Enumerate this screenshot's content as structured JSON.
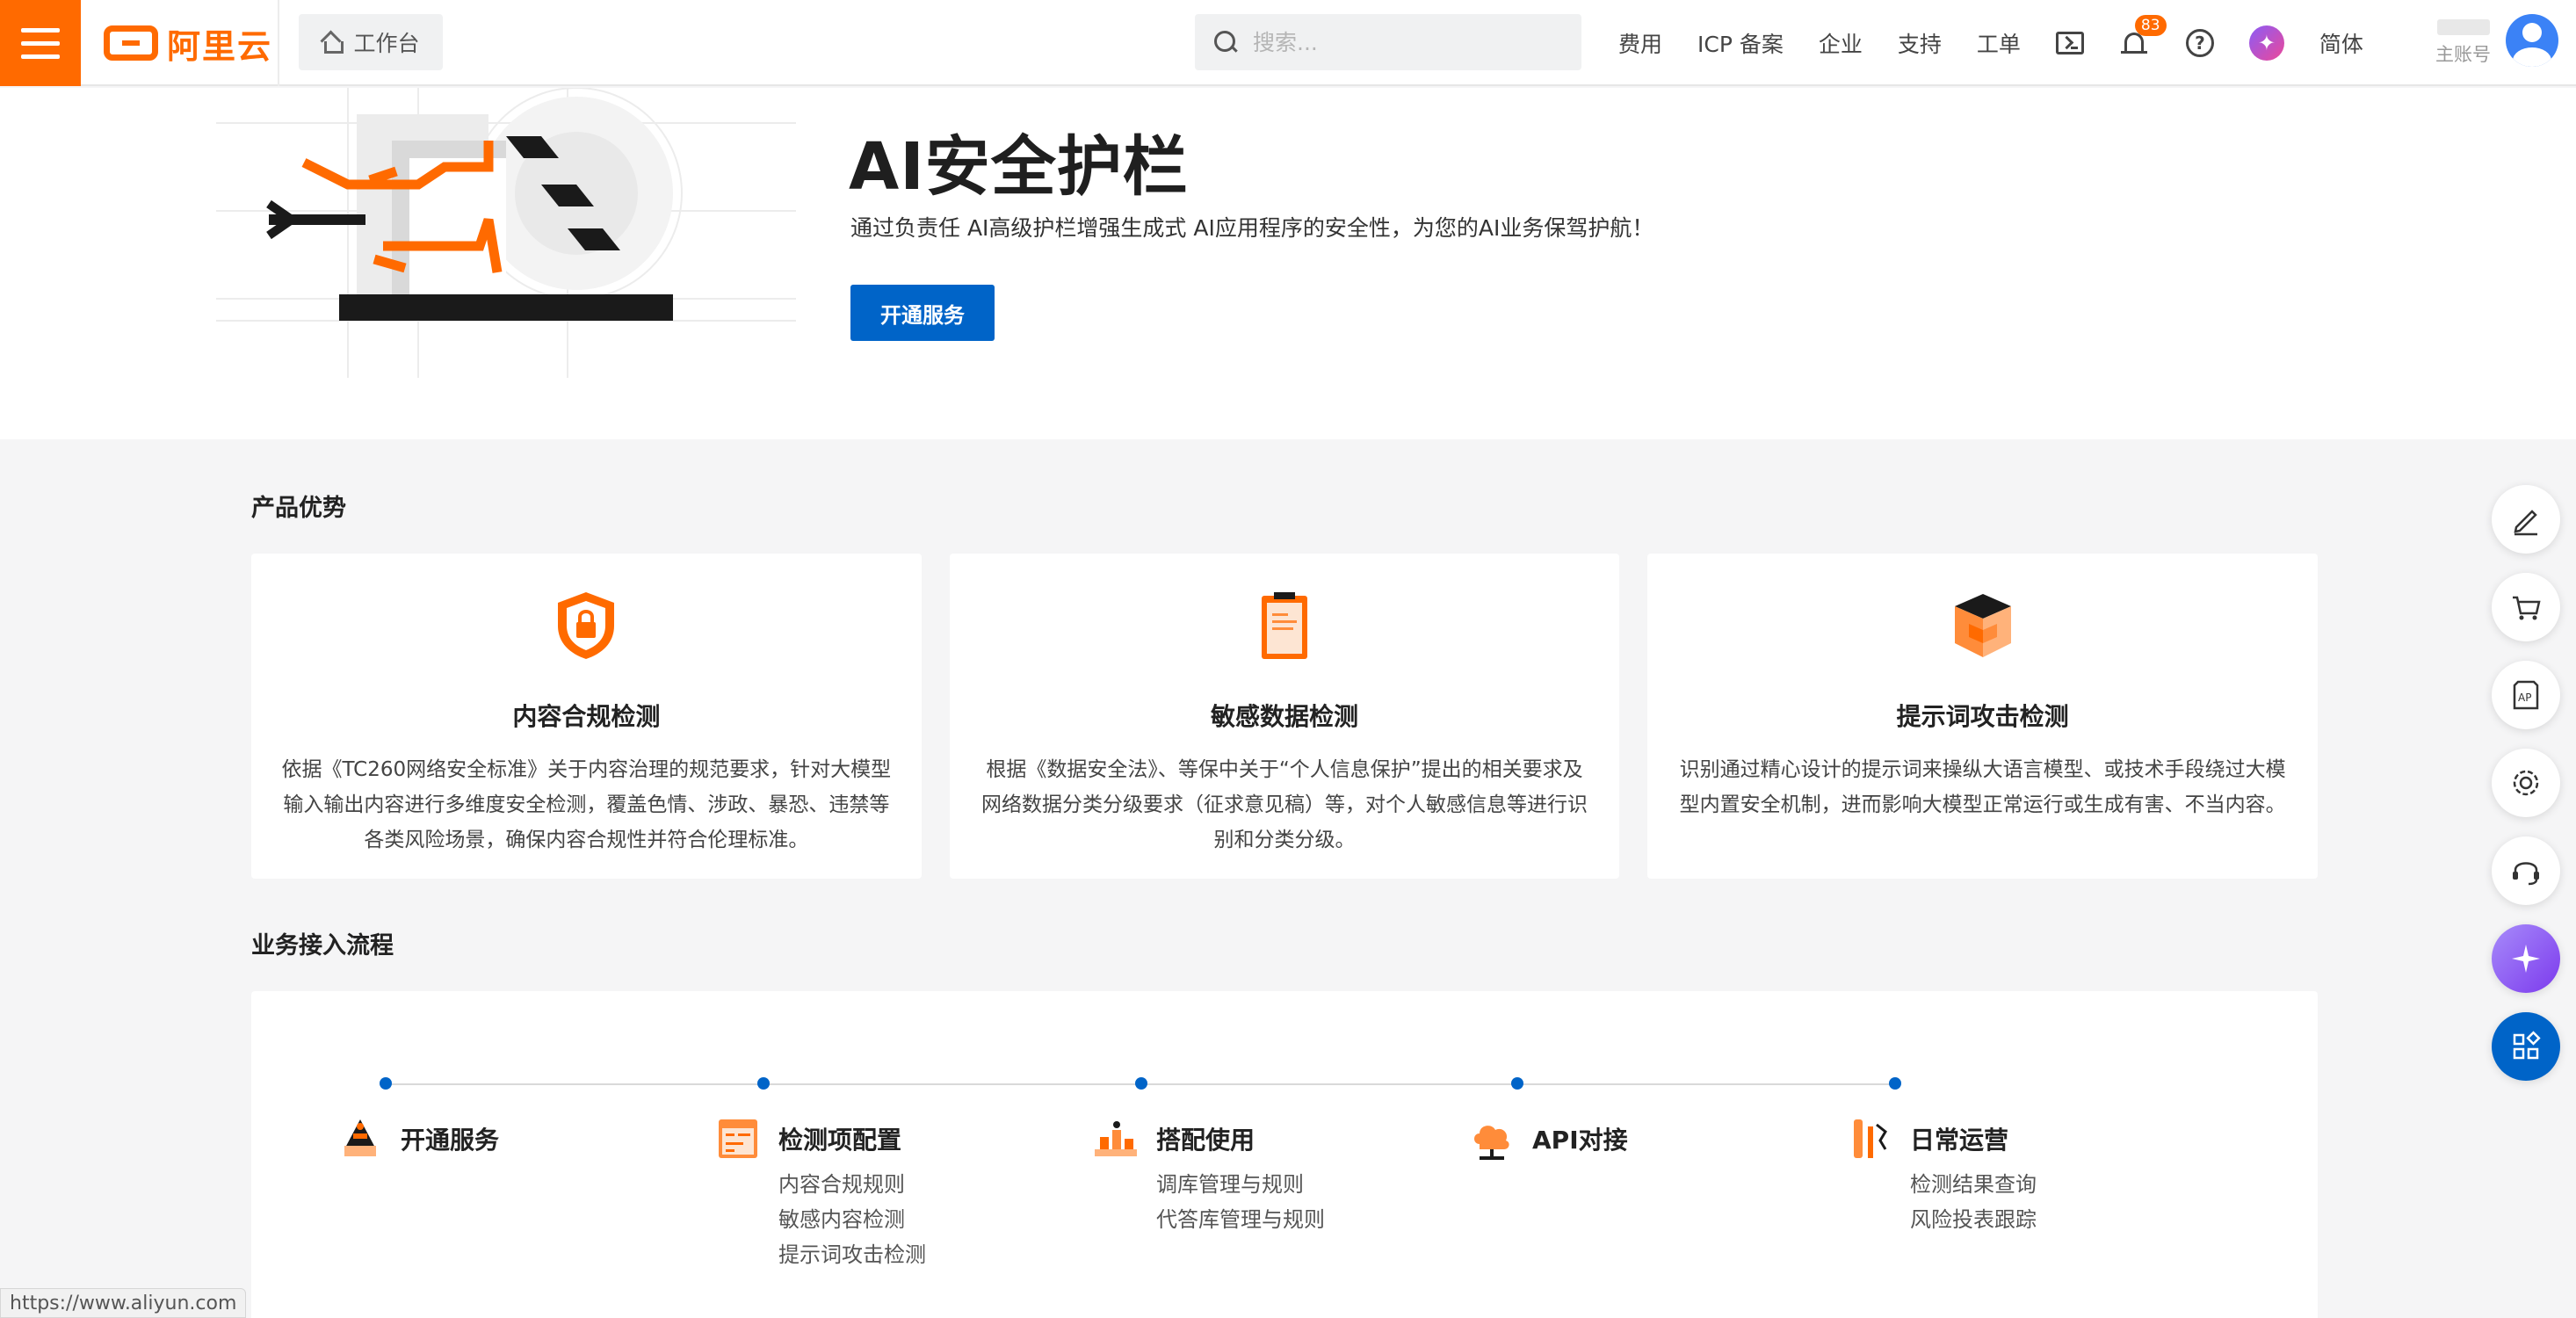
{
  "header": {
    "logo_text": "阿里云",
    "workbench_label": "工作台",
    "search_placeholder": "搜索...",
    "nav": [
      "费用",
      "ICP 备案",
      "企业",
      "支持",
      "工单"
    ],
    "notification_count": "83",
    "language": "简体",
    "account_label": "主账号",
    "brand_color": "#ff6a00"
  },
  "hero": {
    "title": "AI安全护栏",
    "description": "通过负责任 AI高级护栏增强生成式 AI应用程序的安全性，为您的AI业务保驾护航！",
    "button": "开通服务",
    "button_color": "#0064c8"
  },
  "advantages": {
    "title": "产品优势",
    "items": [
      {
        "title": "内容合规检测",
        "desc": "依据《TC260网络安全标准》关于内容治理的规范要求，针对大模型输入输出内容进行多维度安全检测，覆盖色情、涉政、暴恐、违禁等各类风险场景，确保内容合规性并符合伦理标准。",
        "icon": "shield-lock-icon"
      },
      {
        "title": "敏感数据检测",
        "desc": "根据《数据安全法》、等保中关于“个人信息保护”提出的相关要求及网络数据分类分级要求（征求意见稿）等，对个人敏感信息等进行识别和分类分级。",
        "icon": "clipboard-icon"
      },
      {
        "title": "提示词攻击检测",
        "desc": "识别通过精心设计的提示词来操纵大语言模型、或技术手段绕过大模型内置安全机制，进而影响大模型正常运行或生成有害、不当内容。",
        "icon": "cube-icon"
      }
    ]
  },
  "flow": {
    "title": "业务接入流程",
    "steps": [
      {
        "title": "开通服务",
        "subs": []
      },
      {
        "title": "检测项配置",
        "subs": [
          "内容合规规则",
          "敏感内容检测",
          "提示词攻击检测"
        ]
      },
      {
        "title": "搭配使用",
        "subs": [
          "调库管理与规则",
          "代答库管理与规则"
        ]
      },
      {
        "title": "API对接",
        "subs": []
      },
      {
        "title": "日常运营",
        "subs": [
          "检测结果查询",
          "风险投表跟踪"
        ]
      }
    ]
  },
  "side_tools": [
    "edit-icon",
    "cart-icon",
    "api-icon",
    "settings-icon",
    "headset-icon",
    "ai-assistant-icon",
    "apps-grid-icon"
  ],
  "status_url": "https://www.aliyun.com"
}
